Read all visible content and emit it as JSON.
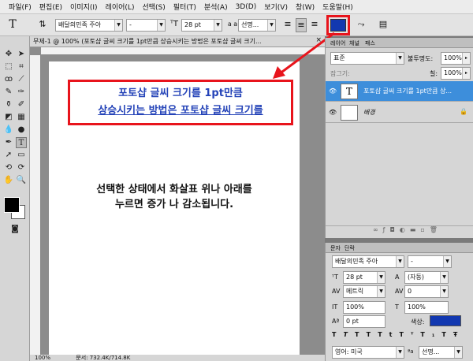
{
  "menu": [
    "파일(F)",
    "편집(E)",
    "이미지(I)",
    "레이어(L)",
    "선택(S)",
    "필터(T)",
    "분석(A)",
    "3D(D)",
    "보기(V)",
    "창(W)",
    "도움말(H)"
  ],
  "options": {
    "font_family": "배달의민족 주아",
    "font_style": "-",
    "font_size": "28 pt",
    "aa_label": "a a",
    "antialias": "선명...",
    "color": "#1238b0"
  },
  "doc_tab": {
    "title": "무제-1 @ 100% (포토샵 글씨 크기를 1pt만큼 상승시키는 방법은 포토샵 글씨 크기...",
    "close": "×"
  },
  "doc_text": {
    "line1": "포토샵 글씨 크기를 1pt만큼",
    "line2": "상승시키는 방법은 포토샵 글씨 크기를",
    "line3": "선택한 상태에서 화살표 위나 아래를",
    "line4": "누르면 증가 나 감소됩니다."
  },
  "status": {
    "zoom": "100%",
    "doc_size": "문서: 732.4K/714.8K"
  },
  "layers_panel": {
    "tabs": [
      "레이어",
      "채널",
      "패스"
    ],
    "blend_mode": "표준",
    "opacity_label": "불투명도:",
    "opacity": "100%",
    "lock_label": "잠그기:",
    "fill_label": "칠:",
    "fill": "100%",
    "layers": [
      {
        "name": "포토샵 글씨 크기를 1pt만큼 상...",
        "thumb": "T",
        "selected": true
      },
      {
        "name": "배경",
        "thumb": "",
        "selected": false
      }
    ]
  },
  "char_panel": {
    "tabs": [
      "문자",
      "단락"
    ],
    "font_family": "배달의민족 주아",
    "font_style": "-",
    "font_size": "28 pt",
    "leading": "(자동)",
    "kerning": "메트릭",
    "tracking": "0",
    "vscale": "100%",
    "hscale": "100%",
    "baseline": "0 pt",
    "color_label": "색상:",
    "color": "#1238b0",
    "language": "영어: 미국",
    "aa": "선명..."
  }
}
